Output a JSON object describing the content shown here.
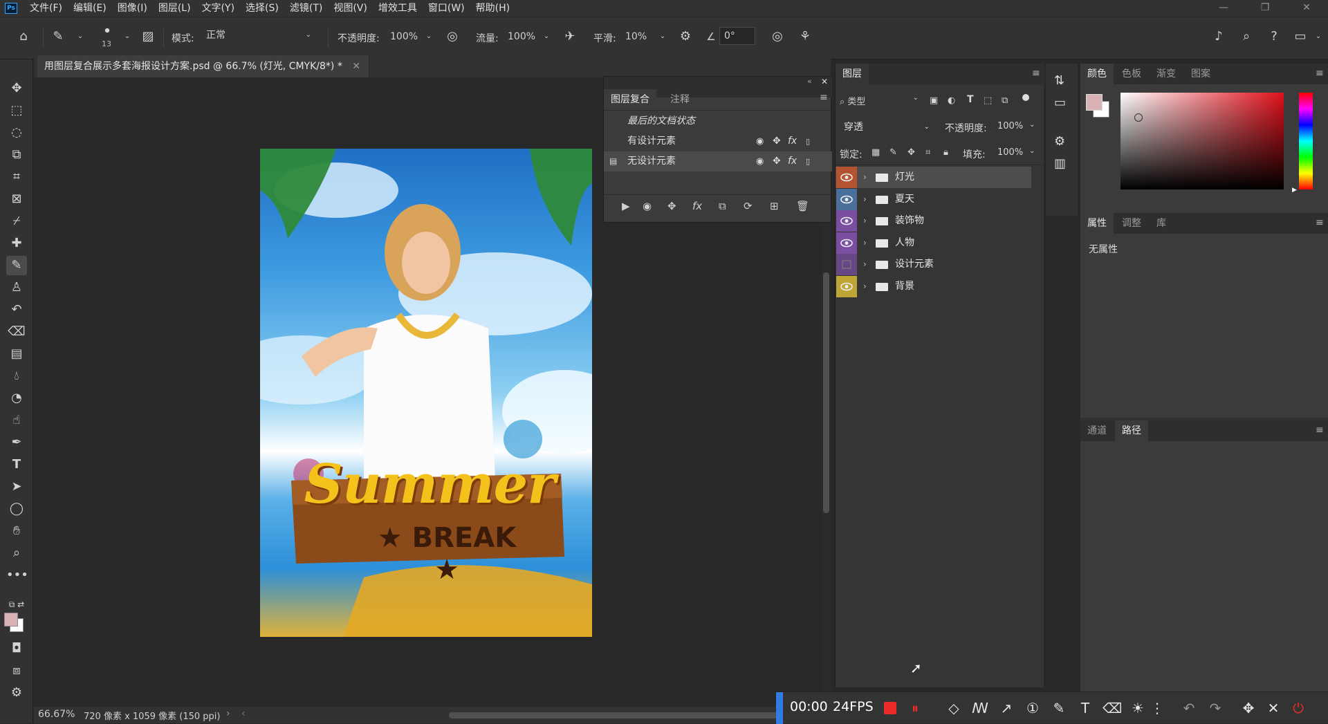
{
  "app": {
    "logo": "Ps"
  },
  "menu": [
    "文件(F)",
    "编辑(E)",
    "图像(I)",
    "图层(L)",
    "文字(Y)",
    "选择(S)",
    "滤镜(T)",
    "视图(V)",
    "增效工具",
    "窗口(W)",
    "帮助(H)"
  ],
  "options": {
    "brush_size": "13",
    "mode_label": "模式:",
    "mode_value": "正常",
    "opacity_label": "不透明度:",
    "opacity_value": "100%",
    "flow_label": "流量:",
    "flow_value": "100%",
    "smooth_label": "平滑:",
    "smooth_value": "10%",
    "angle_value": "0°"
  },
  "document": {
    "tab_title": "用图层复合展示多套海报设计方案.psd @ 66.7% (灯光, CMYK/8*) *",
    "zoom": "66.67%",
    "info": "720 像素 x 1059 像素 (150 ppi)",
    "poster_title": "Summer",
    "poster_subtitle": "★ BREAK ★"
  },
  "comps_panel": {
    "tabs": [
      "图层复合",
      "注释"
    ],
    "rows": [
      {
        "name": "最后的文档状态"
      },
      {
        "name": "有设计元素"
      },
      {
        "name": "无设计元素"
      }
    ]
  },
  "layers_panel": {
    "tab": "图层",
    "filter_label": "类型",
    "blend_mode": "穿透",
    "opacity_label": "不透明度:",
    "opacity_value": "100%",
    "lock_label": "锁定:",
    "fill_label": "填充:",
    "fill_value": "100%",
    "layers": [
      {
        "name": "灯光",
        "color": "#b4532f",
        "visible": true,
        "selected": true
      },
      {
        "name": "夏天",
        "color": "#4a6f9a",
        "visible": true,
        "selected": false
      },
      {
        "name": "装饰物",
        "color": "#7a4ea0",
        "visible": true,
        "selected": false
      },
      {
        "name": "人物",
        "color": "#7a4ea0",
        "visible": true,
        "selected": false
      },
      {
        "name": "设计元素",
        "color": "#7a4ea0",
        "visible": false,
        "selected": false
      },
      {
        "name": "背景",
        "color": "#bfa436",
        "visible": true,
        "selected": false
      }
    ]
  },
  "color_panel": {
    "tabs": [
      "颜色",
      "色板",
      "渐变",
      "图案"
    ],
    "foreground": "#d8b2b4",
    "background": "#ffffff",
    "hue_color": "#e0101a"
  },
  "properties_panel": {
    "tabs": [
      "属性",
      "调整",
      "库"
    ],
    "empty_text": "无属性"
  },
  "paths_panel": {
    "tabs": [
      "通道",
      "路径"
    ]
  },
  "recorder": {
    "time": "00:00",
    "fps": "24FPS"
  }
}
